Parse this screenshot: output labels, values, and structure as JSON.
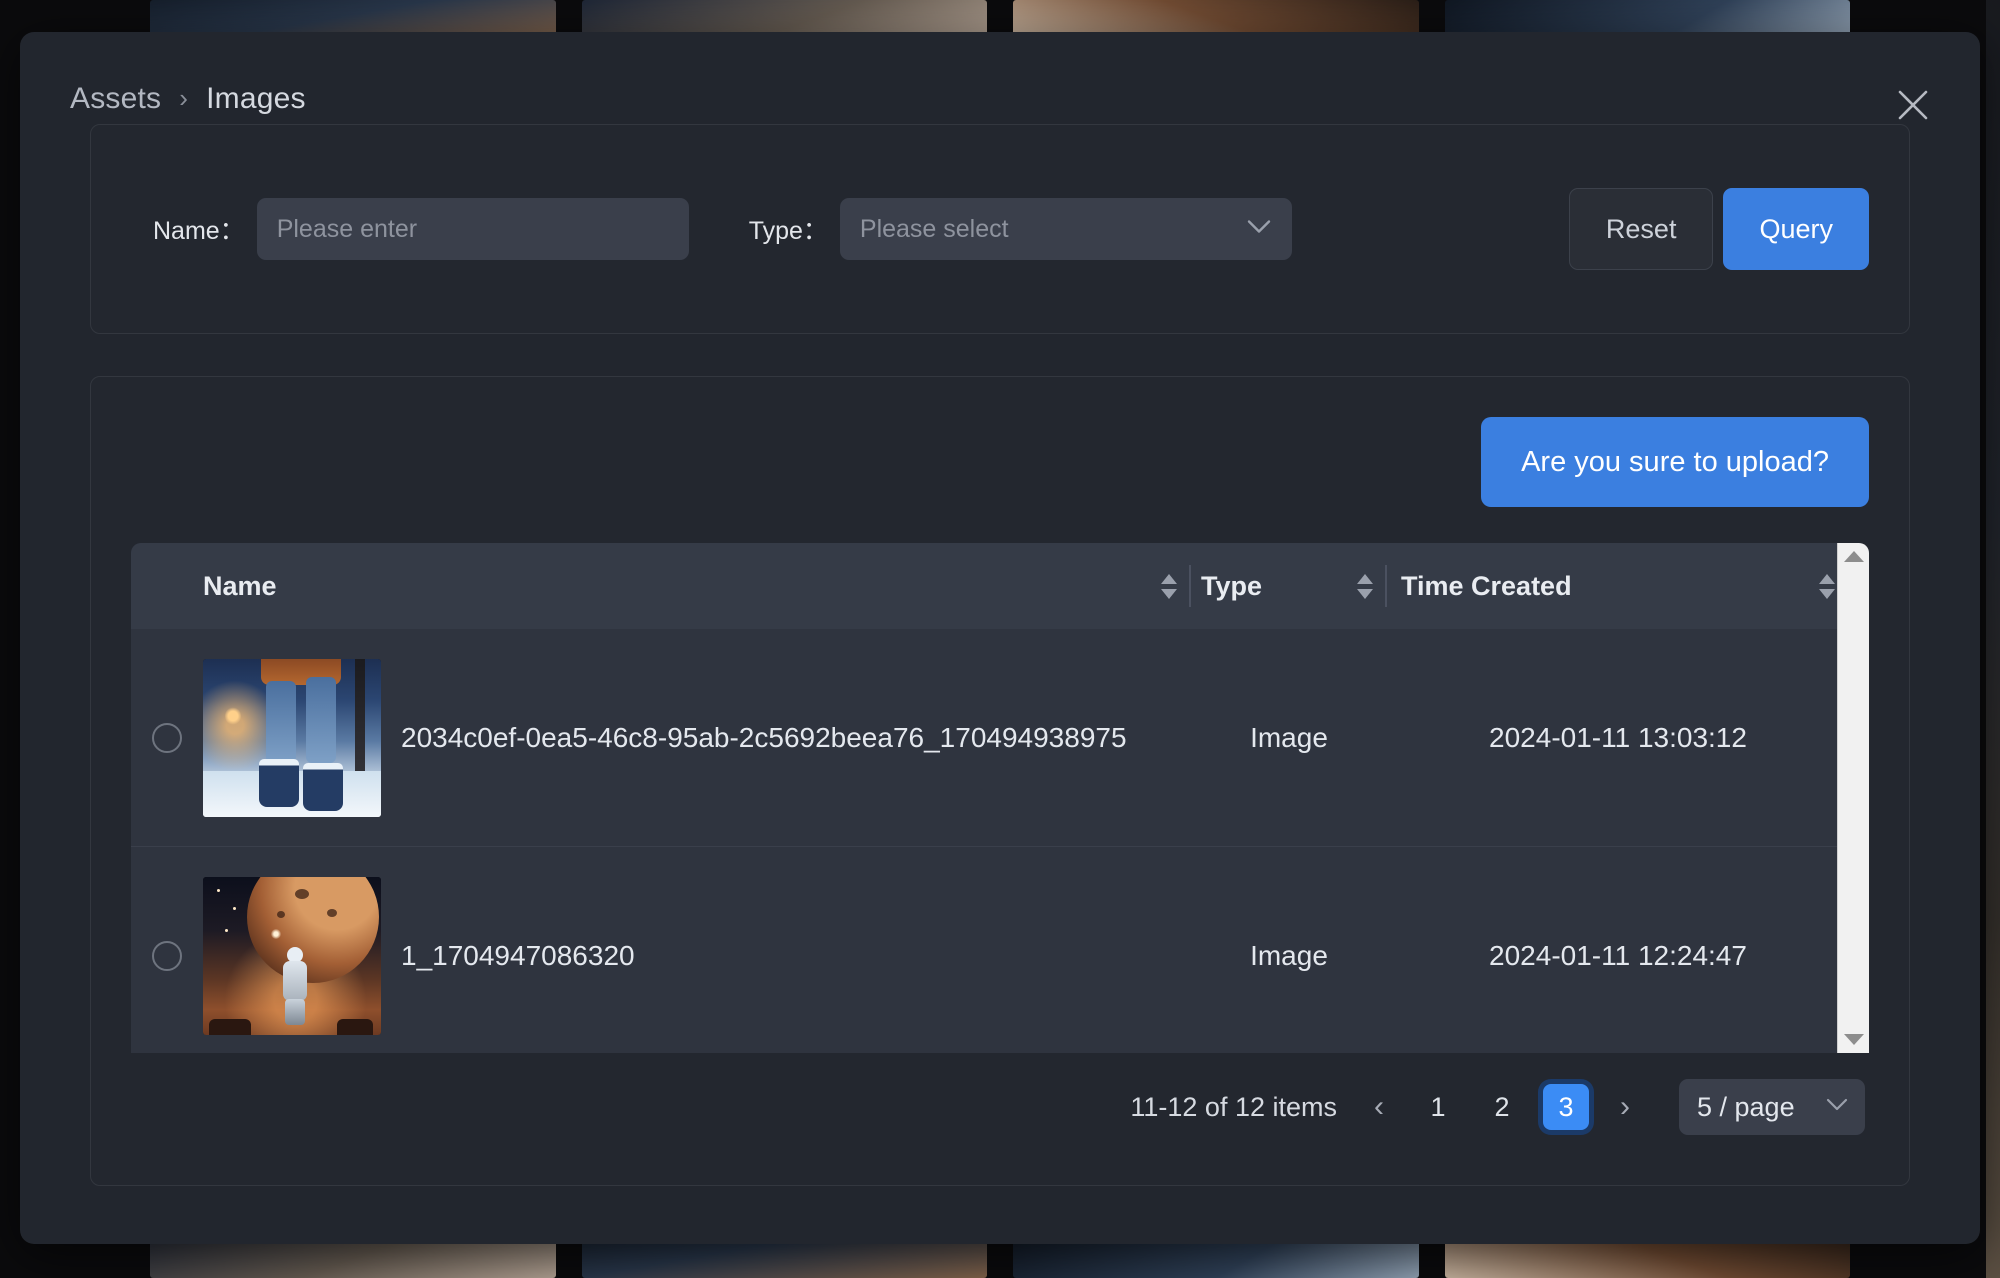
{
  "modal": {
    "breadcrumb": {
      "root": "Assets",
      "separator": "›",
      "current": "Images"
    },
    "close_icon": "close-icon"
  },
  "filter": {
    "name": {
      "label": "Name：",
      "placeholder": "Please enter",
      "value": ""
    },
    "type": {
      "label": "Type：",
      "placeholder": "Please select",
      "value": "",
      "caret_icon": "chevron-down-icon"
    },
    "reset_label": "Reset",
    "query_label": "Query"
  },
  "list": {
    "upload_label": "Are you sure to upload?",
    "columns": [
      {
        "key": "name",
        "label": "Name",
        "sortable": true
      },
      {
        "key": "type",
        "label": "Type",
        "sortable": true
      },
      {
        "key": "time",
        "label": "Time Created",
        "sortable": true
      }
    ],
    "rows": [
      {
        "selected": false,
        "thumbnail": "winter-street-boots-thumbnail",
        "name": "2034c0ef-0ea5-46c8-95ab-2c5692beea76_170494938975",
        "type": "Image",
        "time": "2024-01-11 13:03:12"
      },
      {
        "selected": false,
        "thumbnail": "astronaut-planet-thumbnail",
        "name": "1_1704947086320",
        "type": "Image",
        "time": "2024-01-11 12:24:47"
      }
    ]
  },
  "pagination": {
    "total_text": "11-12 of 12 items",
    "prev_icon": "‹",
    "next_icon": "›",
    "pages": [
      "1",
      "2",
      "3"
    ],
    "current_page": "3",
    "page_size_label": "5 / page",
    "page_size_caret": "chevron-down-icon"
  },
  "colors": {
    "accent_blue": "#3b7fe0",
    "active_page_blue": "#3b8cf5",
    "modal_bg": "#22262e",
    "card_bg": "#23272f",
    "input_bg": "#3a3f4b",
    "table_header_bg": "#353b47",
    "table_row_bg": "#2f343f"
  }
}
